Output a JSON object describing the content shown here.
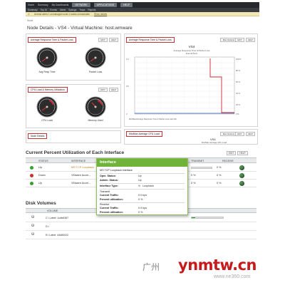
{
  "header": {
    "nav_items": [
      "Home",
      "Summary",
      "My Dashboards",
      "Alerts",
      "Reports"
    ],
    "active_tab": "NETWORK",
    "tabs": [
      "APPLICATIONS",
      "HELP"
    ],
    "menu_items": [
      "Summary",
      "Top 10",
      "Events",
      "Alerts",
      "Syslogs",
      "Traps",
      "Reports"
    ],
    "alert_text": "Unread alerts   1 unmanaged node   4 nodes unreachable",
    "alert_link": "Show details"
  },
  "breadcrumb": "Node",
  "page_title": "Node Details - VS4 - Virtual Machine: host.wmware",
  "panels": {
    "response": {
      "label": "Average Response Time & Packet Loss",
      "gauge1": "Avg Resp Time",
      "gauge2": "Packet Loss",
      "buttons": [
        "EDIT",
        "HELP"
      ]
    },
    "cpu": {
      "label": "CPU Load & Memory Utilization",
      "gauge1": "CPU Load",
      "gauge2": "Memory Used",
      "buttons": [
        "EDIT",
        "HELP"
      ]
    },
    "node": {
      "label": "Node Details"
    },
    "chart1": {
      "label": "Average Response Time & Packet Loss",
      "select": "Max Options",
      "buttons": [
        "EDIT",
        "HELP"
      ],
      "chart_title": "VS4",
      "chart_sub1": "Average Response Time & Packet Loss",
      "chart_sub2": "Interval 5min",
      "footnote": "Min/Max/Average Response Time & Packet Loss Last 24h"
    },
    "chart2": {
      "label": "Min/Max Average CPU Load",
      "select": "Max Options",
      "buttons": [
        "EDIT",
        "HELP"
      ],
      "chart_title": "VS4",
      "chart_sub1": "Min/Max Average CPU Load"
    }
  },
  "interfaces": {
    "title": "Current Percent Utilization of Each Interface",
    "buttons": [
      "EDIT",
      "HELP"
    ],
    "columns": [
      "STATUS",
      "INTERFACE",
      "TRANSMIT",
      "RECEIVE"
    ],
    "rows": [
      {
        "status": "Up",
        "color": "#3aa12f",
        "name": "MS TCP Loopback",
        "tx": "0 %",
        "rx": "0 %",
        "tx_frac": 0.0,
        "rx_frac": 0.0
      },
      {
        "status": "Down",
        "color": "#c8322b",
        "name": "VMware Accel...",
        "tx": "0 %",
        "rx": "0 %",
        "tx_frac": 0.0,
        "rx_frac": 0.0
      },
      {
        "status": "Up",
        "color": "#3aa12f",
        "name": "VMware Accel...",
        "tx": "0 %",
        "rx": "0 %",
        "tx_frac": 0.0,
        "rx_frac": 0.0
      }
    ]
  },
  "disks": {
    "title": "Disk Volumes",
    "columns": [
      "VOLUME"
    ],
    "rows": [
      {
        "label": "C:\\ Label: 1cdb6387",
        "frac": 0.12
      },
      {
        "label": "D:\\",
        "frac": 0.0
      },
      {
        "label": "E:\\ Label: 44d80022",
        "frac": 0.08
      }
    ]
  },
  "popup": {
    "title": "Interface",
    "name": "MS TCP Loopback interface",
    "fields": [
      {
        "label": "Oper. Status:",
        "value": "Up"
      },
      {
        "label": "Admin. Status:",
        "value": "Up"
      },
      {
        "label": "Interface Type:",
        "value": "Loopback"
      }
    ],
    "transmit_head": "Transmit",
    "transmit": [
      {
        "label": "Current Traffic:",
        "value": "0.0 bps"
      },
      {
        "label": "Percent utilization:",
        "value": "0 %"
      }
    ],
    "receive_head": "Receive",
    "receive": [
      {
        "label": "Current Traffic:",
        "value": "0.0 bps"
      },
      {
        "label": "Percent utilization:",
        "value": "0 %"
      }
    ]
  },
  "watermark": {
    "brand": "ynmtw.cn",
    "cn": "广州",
    "url": "www.ne360.com"
  }
}
